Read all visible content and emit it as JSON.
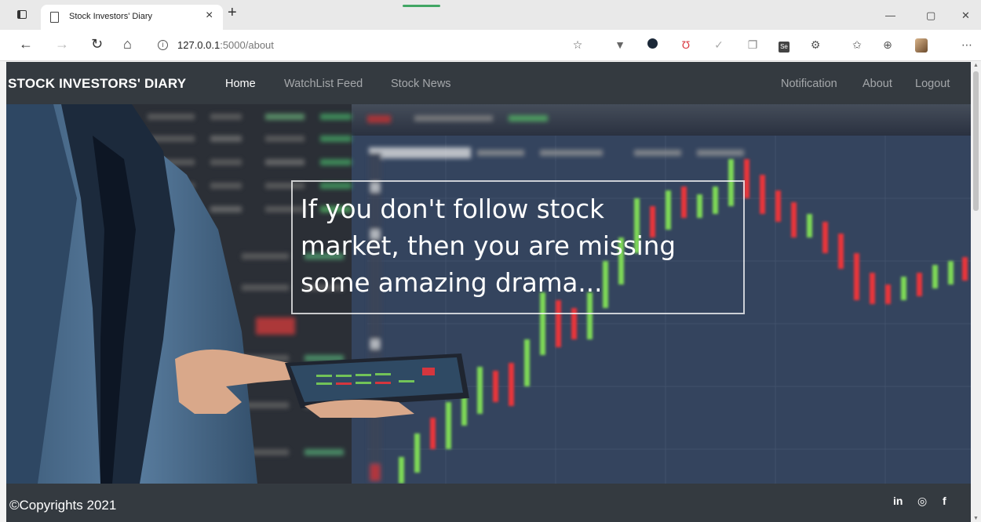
{
  "browser": {
    "tab_title": "Stock Investors' Diary",
    "tab_close": "×",
    "new_tab": "+",
    "url_host": "127.0.0.1",
    "url_path": ":5000/about",
    "window_min": "—",
    "window_max": "▢",
    "window_close": "✕"
  },
  "navbar": {
    "brand": "STOCK INVESTORS' DIARY",
    "links_left": [
      "Home",
      "WatchList Feed",
      "Stock News"
    ],
    "links_right": [
      "Notification",
      "About",
      "Logout"
    ]
  },
  "hero": {
    "quote_line1": "If you don't follow stock",
    "quote_line2": "market, then you are missing",
    "quote_line3": "some amazing drama..."
  },
  "footer": {
    "copyright": "©Copyrights 2021",
    "social": [
      "in",
      "◎",
      "f"
    ]
  },
  "colors": {
    "navbar_bg": "#343a40",
    "candle_green": "#7ed957",
    "candle_red": "#e8343a"
  },
  "icons": [
    "square-tab-icon",
    "page-icon",
    "back-arrow-icon",
    "forward-arrow-icon",
    "reload-icon",
    "home-icon",
    "info-icon",
    "linkedin-icon",
    "instagram-icon",
    "facebook-icon"
  ]
}
